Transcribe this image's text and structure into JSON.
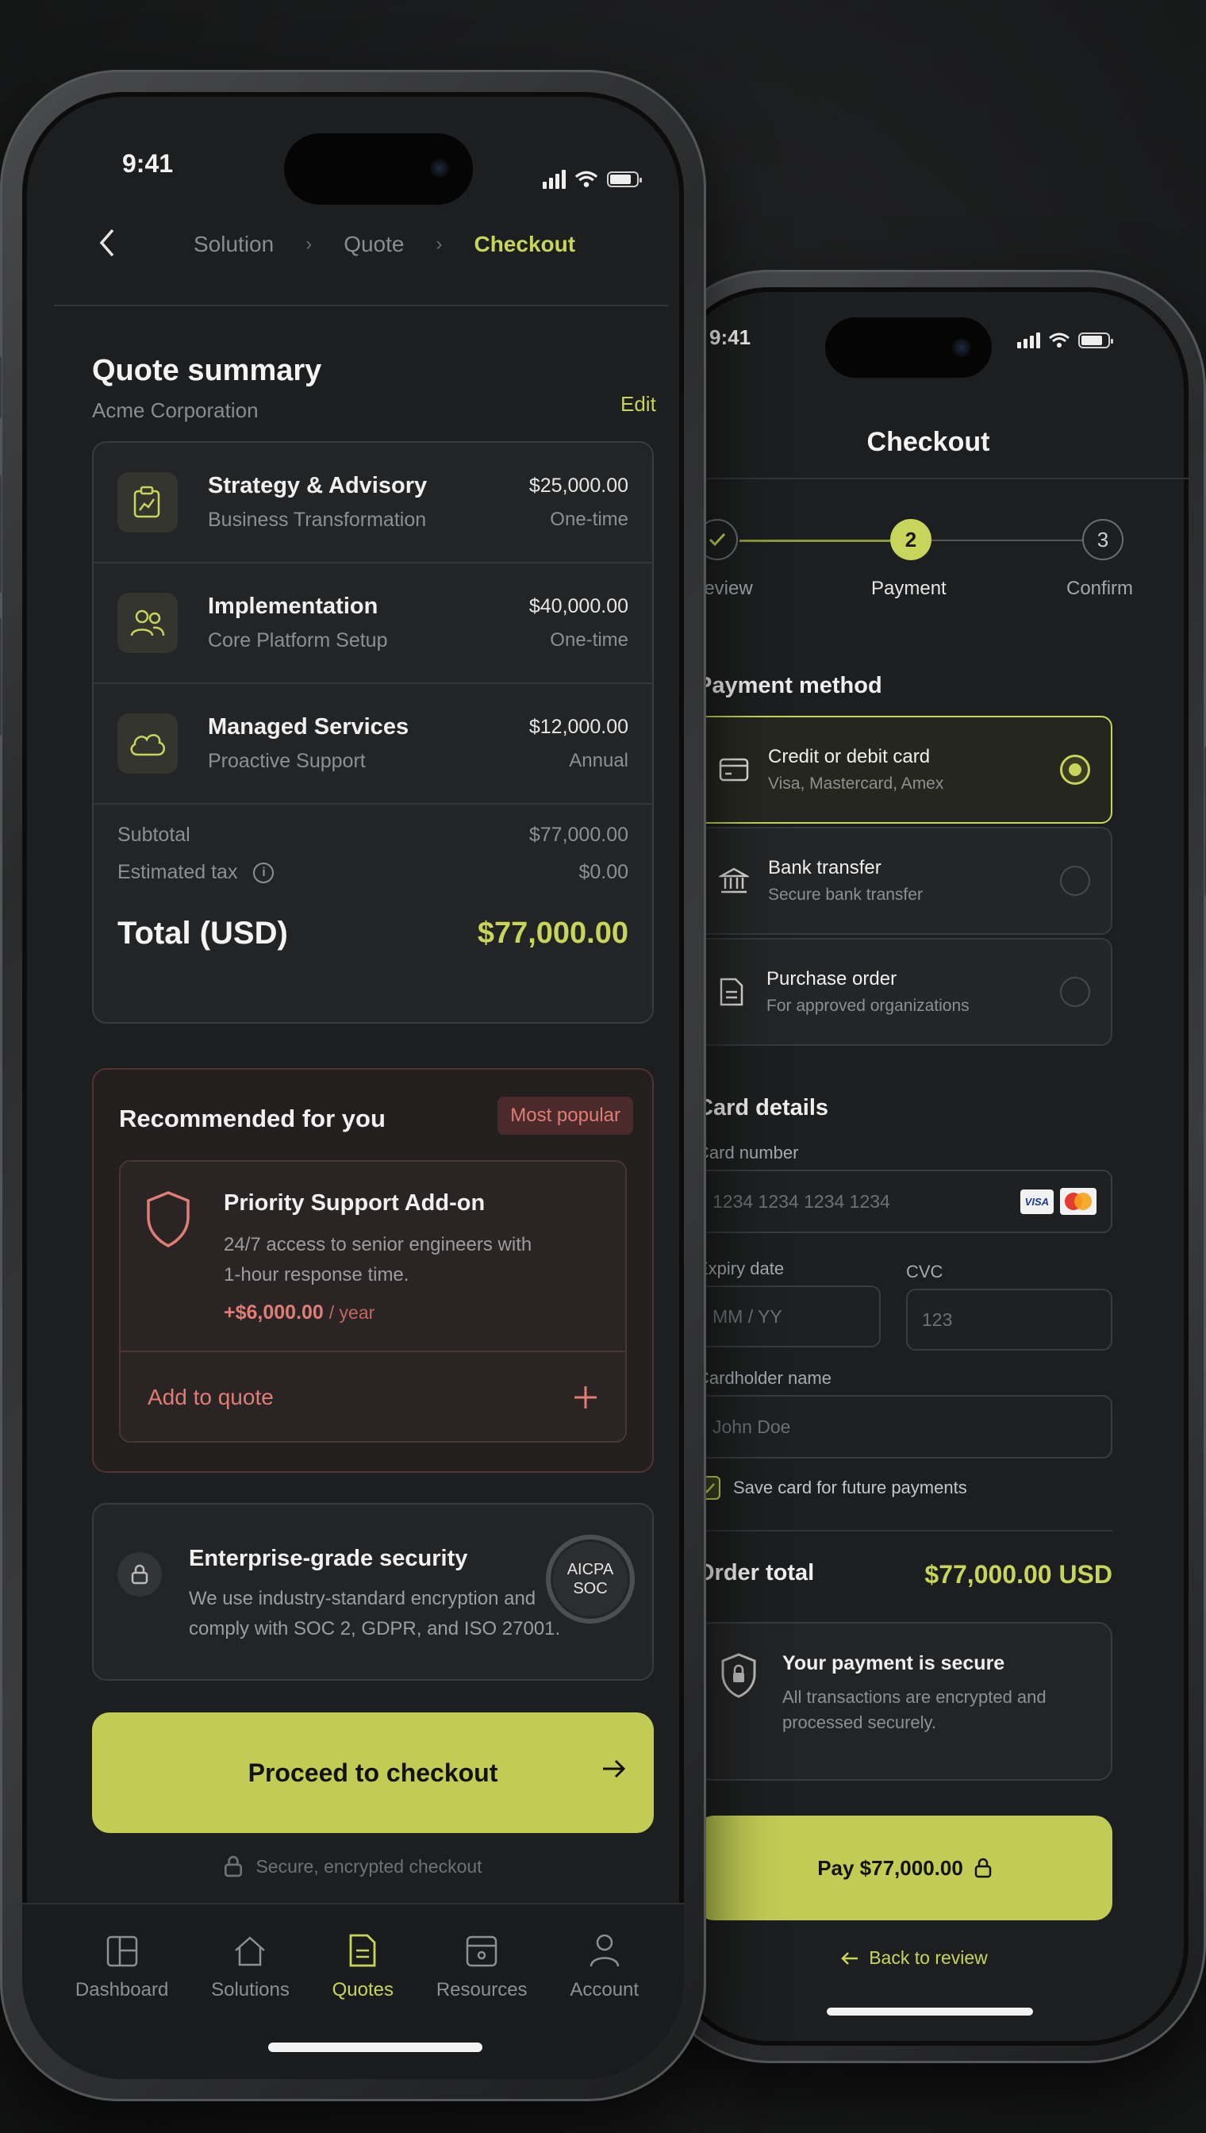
{
  "left_phone": {
    "status": {
      "time": "9:41"
    },
    "breadcrumb": [
      "Solution",
      "Quote",
      "Checkout"
    ],
    "quote_summary": {
      "title": "Quote summary",
      "company": "Acme Corporation",
      "edit_label": "Edit",
      "items": [
        {
          "name": "Strategy & Advisory",
          "desc": "Business Transformation",
          "amount": "$25,000.00",
          "frequency": "One-time",
          "icon": "strategy-icon"
        },
        {
          "name": "Implementation",
          "desc": "Core Platform Setup",
          "amount": "$40,000.00",
          "frequency": "One-time",
          "icon": "users-icon"
        },
        {
          "name": "Managed Services",
          "desc": "Proactive Support",
          "amount": "$12,000.00",
          "frequency": "Annual",
          "icon": "cloud-icon"
        }
      ],
      "subtotal_label": "Subtotal",
      "subtotal_value": "$77,000.00",
      "tax_label": "Estimated tax",
      "tax_value": "$0.00",
      "total_label": "Total (USD)",
      "total_value": "$77,000.00"
    },
    "recommended": {
      "title": "Recommended for you",
      "badge": "Most popular",
      "addon_title": "Priority Support Add-on",
      "addon_desc_1": "24/7 access to senior engineers with",
      "addon_desc_2": "1-hour response time.",
      "addon_price": "+$6,000.00",
      "addon_period": "/ year",
      "add_label": "Add to quote"
    },
    "security": {
      "title": "Enterprise-grade security",
      "desc_1": "We use industry-standard encryption and",
      "desc_2": "comply with SOC 2, GDPR, and ISO 27001.",
      "badge_1": "AICPA",
      "badge_2": "SOC"
    },
    "cta_label": "Proceed to checkout",
    "secure_note": "Secure, encrypted checkout",
    "tabs": [
      {
        "label": "Dashboard",
        "icon": "dashboard-icon"
      },
      {
        "label": "Solutions",
        "icon": "home-icon"
      },
      {
        "label": "Quotes",
        "icon": "document-icon"
      },
      {
        "label": "Resources",
        "icon": "folder-icon"
      },
      {
        "label": "Account",
        "icon": "person-icon"
      }
    ],
    "active_tab": "Quotes"
  },
  "right_phone": {
    "status": {
      "time": "9:41"
    },
    "title": "Checkout",
    "steps": [
      {
        "num": "",
        "label": "Review",
        "state": "done"
      },
      {
        "num": "2",
        "label": "Payment",
        "state": "current"
      },
      {
        "num": "3",
        "label": "Confirm",
        "state": "upcoming"
      }
    ],
    "payment_method_title": "Payment method",
    "payment_methods": [
      {
        "title": "Credit or debit card",
        "sub": "Visa, Mastercard, Amex",
        "icon": "card-icon",
        "selected": true
      },
      {
        "title": "Bank transfer",
        "sub": "Secure bank transfer",
        "icon": "bank-icon",
        "selected": false
      },
      {
        "title": "Purchase order",
        "sub": "For approved organizations",
        "icon": "document-icon",
        "selected": false
      }
    ],
    "card_details_title": "Card details",
    "card_number_label": "Card number",
    "card_number_placeholder": "1234 1234 1234 1234",
    "card_brands": [
      "VISA",
      "mastercard"
    ],
    "expiry_label": "Expiry date",
    "expiry_placeholder": "MM / YY",
    "cvc_label": "CVC",
    "cvc_placeholder": "123",
    "name_label": "Cardholder name",
    "name_placeholder": "John Doe",
    "save_card_label": "Save card for future payments",
    "save_card_checked": true,
    "order_total_label": "Order total",
    "order_total_value": "$77,000.00 USD",
    "secure_title": "Your payment is secure",
    "secure_desc_1": "All transactions are encrypted and",
    "secure_desc_2": "processed securely.",
    "pay_label": "Pay $77,000.00",
    "back_label": "Back to review"
  },
  "colors": {
    "accent": "#c9d45a",
    "cta": "#c2cc55",
    "danger": "#e07d74",
    "bg": "#1d1e1f"
  }
}
